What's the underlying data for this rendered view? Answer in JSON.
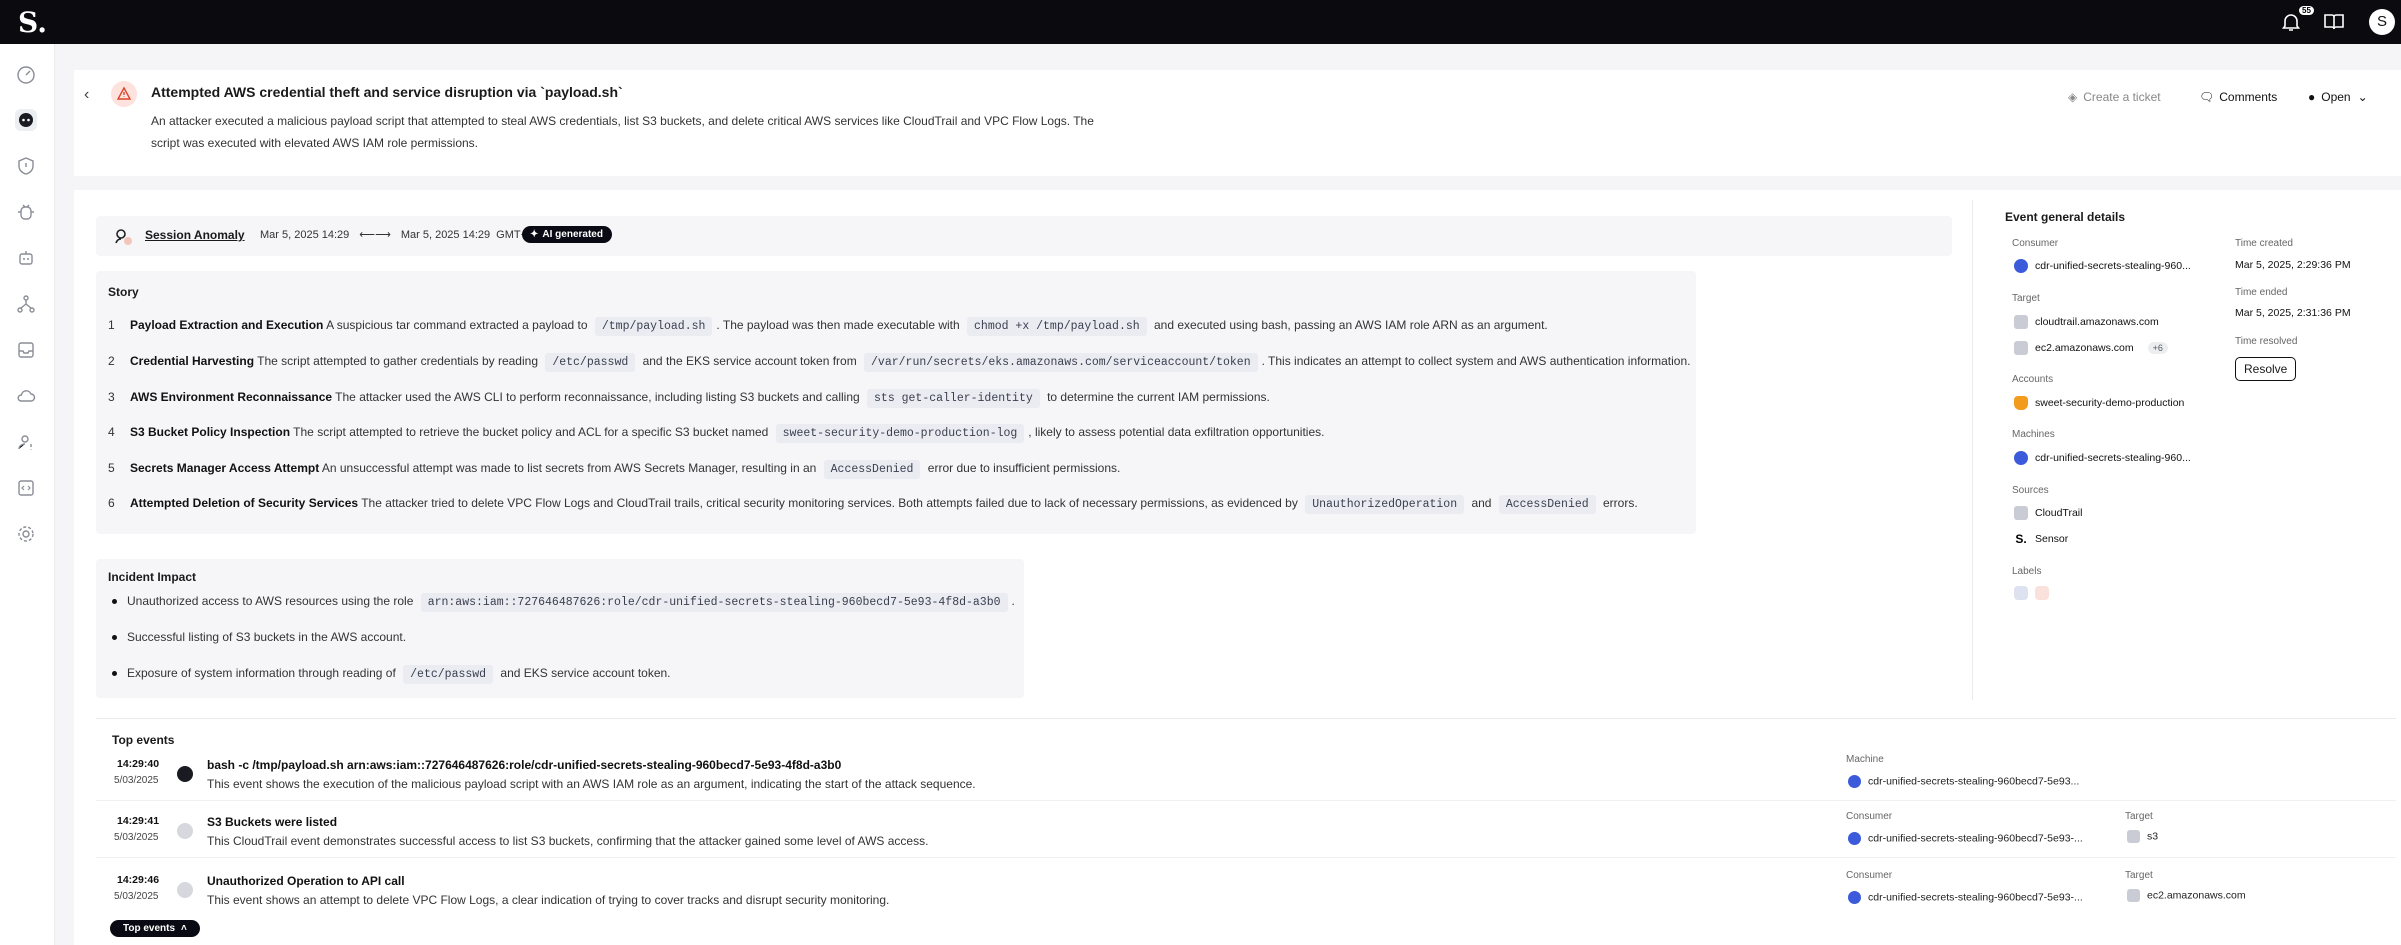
{
  "app": {
    "logo": "S.",
    "notification_count": "55",
    "avatar_initial": "S"
  },
  "incident": {
    "title": "Attempted AWS credential theft and service disruption via `payload.sh`",
    "description": "An attacker executed a malicious payload script that attempted to steal AWS credentials, list S3 buckets, and delete critical AWS services like CloudTrail and VPC Flow Logs. The script was executed with elevated AWS IAM role permissions.",
    "create_ticket_label": "Create a ticket",
    "comments_label": "Comments",
    "status_label": "Open"
  },
  "anomaly": {
    "link": "Session Anomaly",
    "start": "Mar 5, 2025 14:29",
    "end": "Mar 5, 2025 14:29",
    "timezone": "GMT+2",
    "ai_badge": "AI generated"
  },
  "story": {
    "heading": "Story",
    "items": [
      {
        "num": "1",
        "title": "Payload Extraction and Execution",
        "t1": " A suspicious tar command extracted a payload to ",
        "c1": "/tmp/payload.sh",
        "t2": ". The payload was then made executable with ",
        "c2": "chmod +x /tmp/payload.sh",
        "t3": " and executed using bash, passing an AWS IAM role ARN as an argument."
      },
      {
        "num": "2",
        "title": "Credential Harvesting",
        "t1": " The script attempted to gather credentials by reading ",
        "c1": "/etc/passwd",
        "t2": " and the EKS service account token from ",
        "c2": "/var/run/secrets/eks.amazonaws.com/serviceaccount/token",
        "t3": ". This indicates an attempt to collect system and AWS authentication information."
      },
      {
        "num": "3",
        "title": "AWS Environment Reconnaissance",
        "t1": " The attacker used the AWS CLI to perform reconnaissance, including listing S3 buckets and calling ",
        "c1": "sts get-caller-identity",
        "t2": " to determine the current IAM permissions.",
        "c2": "",
        "t3": ""
      },
      {
        "num": "4",
        "title": "S3 Bucket Policy Inspection",
        "t1": " The script attempted to retrieve the bucket policy and ACL for a specific S3 bucket named ",
        "c1": "sweet-security-demo-production-log",
        "t2": ", likely to assess potential data exfiltration opportunities.",
        "c2": "",
        "t3": ""
      },
      {
        "num": "5",
        "title": "Secrets Manager Access Attempt",
        "t1": " An unsuccessful attempt was made to list secrets from AWS Secrets Manager, resulting in an ",
        "c1": "AccessDenied",
        "t2": " error due to insufficient permissions.",
        "c2": "",
        "t3": ""
      },
      {
        "num": "6",
        "title": "Attempted Deletion of Security Services",
        "t1": " The attacker tried to delete VPC Flow Logs and CloudTrail trails, critical security monitoring services. Both attempts failed due to lack of necessary permissions, as evidenced by ",
        "c1": "UnauthorizedOperation",
        "t2": " and ",
        "c2": "AccessDenied",
        "t3": " errors."
      }
    ]
  },
  "impact": {
    "heading": "Incident Impact",
    "items": [
      {
        "t1": "Unauthorized access to AWS resources using the role ",
        "c1": "arn:aws:iam::727646487626:role/cdr-unified-secrets-stealing-960becd7-5e93-4f8d-a3b0",
        "t2": "."
      },
      {
        "t1": "Successful listing of S3 buckets in the AWS account.",
        "c1": "",
        "t2": ""
      },
      {
        "t1": "Exposure of system information through reading of ",
        "c1": "/etc/passwd",
        "t2": " and EKS service account token."
      }
    ]
  },
  "details": {
    "title": "Event general details",
    "consumer_label": "Consumer",
    "consumer": "cdr-unified-secrets-stealing-960...",
    "target_label": "Target",
    "targets": [
      "cloudtrail.amazonaws.com",
      "ec2.amazonaws.com"
    ],
    "targets_more": "+6",
    "accounts_label": "Accounts",
    "account": "sweet-security-demo-production",
    "machines_label": "Machines",
    "machine": "cdr-unified-secrets-stealing-960...",
    "sources_label": "Sources",
    "sources": [
      "CloudTrail",
      "Sensor"
    ],
    "labels_label": "Labels",
    "time_created_label": "Time created",
    "time_created": "Mar 5, 2025, 2:29:36 PM",
    "time_ended_label": "Time ended",
    "time_ended": "Mar 5, 2025, 2:31:36 PM",
    "time_resolved_label": "Time resolved",
    "resolve_label": "Resolve"
  },
  "top_events": {
    "title": "Top events",
    "pill_label": "Top events",
    "events": [
      {
        "time": "14:29:40",
        "date": "5/03/2025",
        "title": "bash -c /tmp/payload.sh arn:aws:iam::727646487626:role/cdr-unified-secrets-stealing-960becd7-5e93-4f8d-a3b0",
        "desc": "This event shows the execution of the malicious payload script with an AWS IAM role as an argument, indicating the start of the attack sequence.",
        "meta1_label": "Machine",
        "meta1_val": "cdr-unified-secrets-stealing-960becd7-5e93...",
        "meta2_label": "",
        "meta2_val": ""
      },
      {
        "time": "14:29:41",
        "date": "5/03/2025",
        "title": "S3 Buckets were listed",
        "desc": "This CloudTrail event demonstrates successful access to list S3 buckets, confirming that the attacker gained some level of AWS access.",
        "meta1_label": "Consumer",
        "meta1_val": "cdr-unified-secrets-stealing-960becd7-5e93-...",
        "meta2_label": "Target",
        "meta2_val": "s3"
      },
      {
        "time": "14:29:46",
        "date": "5/03/2025",
        "title": "Unauthorized Operation to API call",
        "desc": "This event shows an attempt to delete VPC Flow Logs, a clear indication of trying to cover tracks and disrupt security monitoring.",
        "meta1_label": "Consumer",
        "meta1_val": "cdr-unified-secrets-stealing-960becd7-5e93-...",
        "meta2_label": "Target",
        "meta2_val": "ec2.amazonaws.com"
      }
    ]
  }
}
